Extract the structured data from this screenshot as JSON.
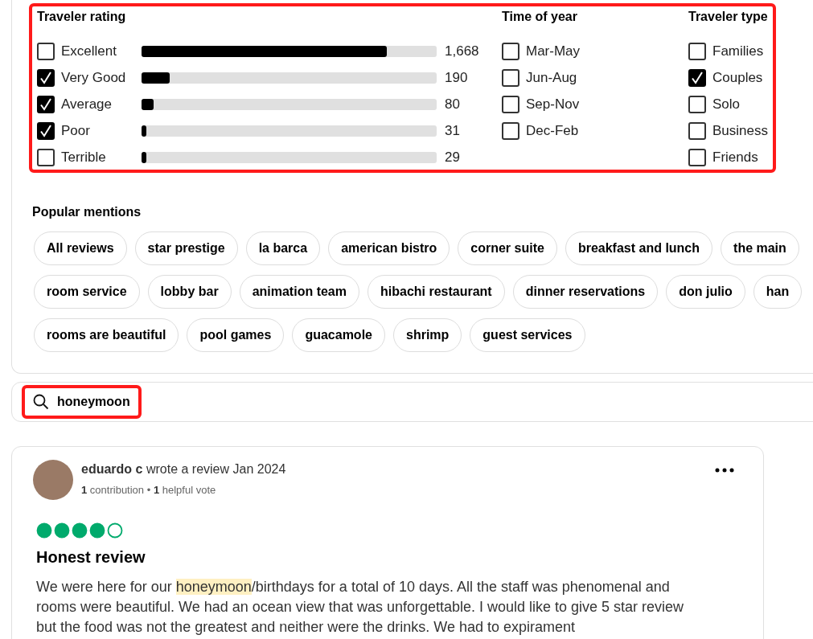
{
  "filters": {
    "rating": {
      "title": "Traveler rating",
      "items": [
        {
          "label": "Excellent",
          "checked": false,
          "level": 0.83,
          "count": "1,668"
        },
        {
          "label": "Very Good",
          "checked": true,
          "level": 0.095,
          "count": "190"
        },
        {
          "label": "Average",
          "checked": true,
          "level": 0.04,
          "count": "80"
        },
        {
          "label": "Poor",
          "checked": true,
          "level": 0.015,
          "count": "31"
        },
        {
          "label": "Terrible",
          "checked": false,
          "level": 0.015,
          "count": "29"
        }
      ]
    },
    "time_of_year": {
      "title": "Time of year",
      "items": [
        {
          "label": "Mar-May",
          "checked": false
        },
        {
          "label": "Jun-Aug",
          "checked": false
        },
        {
          "label": "Sep-Nov",
          "checked": false
        },
        {
          "label": "Dec-Feb",
          "checked": false
        }
      ]
    },
    "traveler_type": {
      "title": "Traveler type",
      "items": [
        {
          "label": "Families",
          "checked": false
        },
        {
          "label": "Couples",
          "checked": true
        },
        {
          "label": "Solo",
          "checked": false
        },
        {
          "label": "Business",
          "checked": false
        },
        {
          "label": "Friends",
          "checked": false
        }
      ]
    }
  },
  "popular_mentions": {
    "title": "Popular mentions",
    "rows": [
      [
        "All reviews",
        "star prestige",
        "la barca",
        "american bistro",
        "corner suite",
        "breakfast and lunch",
        "the main"
      ],
      [
        "room service",
        "lobby bar",
        "animation team",
        "hibachi restaurant",
        "dinner reservations",
        "don julio",
        "han"
      ],
      [
        "rooms are beautiful",
        "pool games",
        "guacamole",
        "shrimp",
        "guest services"
      ]
    ]
  },
  "search": {
    "value": "honeymoon"
  },
  "review": {
    "author": "eduardo c",
    "action": "wrote a review Jan 2024",
    "contributions": "1",
    "contributions_label": "contribution",
    "separator": "•",
    "votes": "1",
    "votes_label": "helpful vote",
    "stars": 4,
    "title": "Honest review",
    "body_before": "We were here for our ",
    "body_highlight": "honeymoon",
    "body_after": "/birthdays for a total of 10 days. All the staff was phenomenal and rooms were beautiful. We had an ocean view that was unforgettable. I would like to give 5 star review but the food was not the greatest and neither were the drinks. We had to expirament"
  }
}
